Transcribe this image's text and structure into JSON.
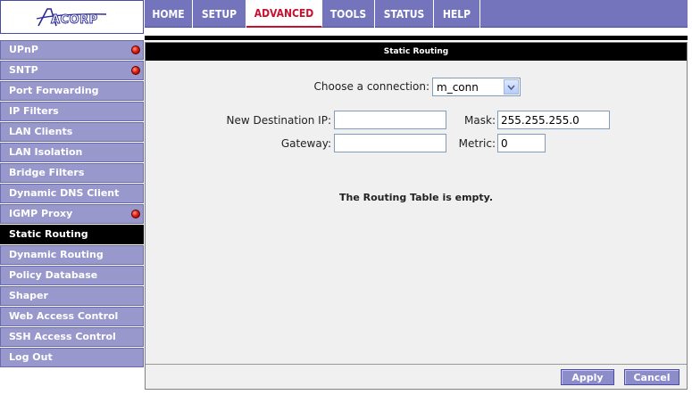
{
  "logo": {
    "text": "ACORP"
  },
  "nav": {
    "tabs": [
      {
        "label": "HOME"
      },
      {
        "label": "SETUP"
      },
      {
        "label": "ADVANCED"
      },
      {
        "label": "TOOLS"
      },
      {
        "label": "STATUS"
      },
      {
        "label": "HELP"
      }
    ],
    "active_tab": "ADVANCED"
  },
  "sidebar": {
    "items": [
      {
        "label": "UPnP",
        "alert": true
      },
      {
        "label": "SNTP",
        "alert": true
      },
      {
        "label": "Port Forwarding",
        "alert": false
      },
      {
        "label": "IP Filters",
        "alert": false
      },
      {
        "label": "LAN Clients",
        "alert": false
      },
      {
        "label": "LAN Isolation",
        "alert": false
      },
      {
        "label": "Bridge Filters",
        "alert": false
      },
      {
        "label": "Dynamic DNS Client",
        "alert": false
      },
      {
        "label": "IGMP Proxy",
        "alert": true
      },
      {
        "label": "Static Routing",
        "alert": false
      },
      {
        "label": "Dynamic Routing",
        "alert": false
      },
      {
        "label": "Policy Database",
        "alert": false
      },
      {
        "label": "Shaper",
        "alert": false
      },
      {
        "label": "Web Access Control",
        "alert": false
      },
      {
        "label": "SSH Access Control",
        "alert": false
      },
      {
        "label": "Log Out",
        "alert": false
      }
    ],
    "active_item": "Static Routing"
  },
  "main": {
    "title": "Static Routing",
    "connection": {
      "label": "Choose a connection:",
      "value": "m_conn"
    },
    "destination": {
      "label": "New Destination IP:",
      "value": ""
    },
    "mask": {
      "label": "Mask:",
      "value": "255.255.255.0"
    },
    "gateway": {
      "label": "Gateway:",
      "value": ""
    },
    "metric": {
      "label": "Metric:",
      "value": "0"
    },
    "empty_message": "The Routing Table is empty.",
    "buttons": {
      "apply": "Apply",
      "cancel": "Cancel"
    }
  },
  "colors": {
    "nav_bg": "#7474bd",
    "sidebar_bg": "#9898cc",
    "active_bg": "#000000",
    "accent_red": "#c8102e",
    "panel_bg": "#f0f0f0"
  }
}
